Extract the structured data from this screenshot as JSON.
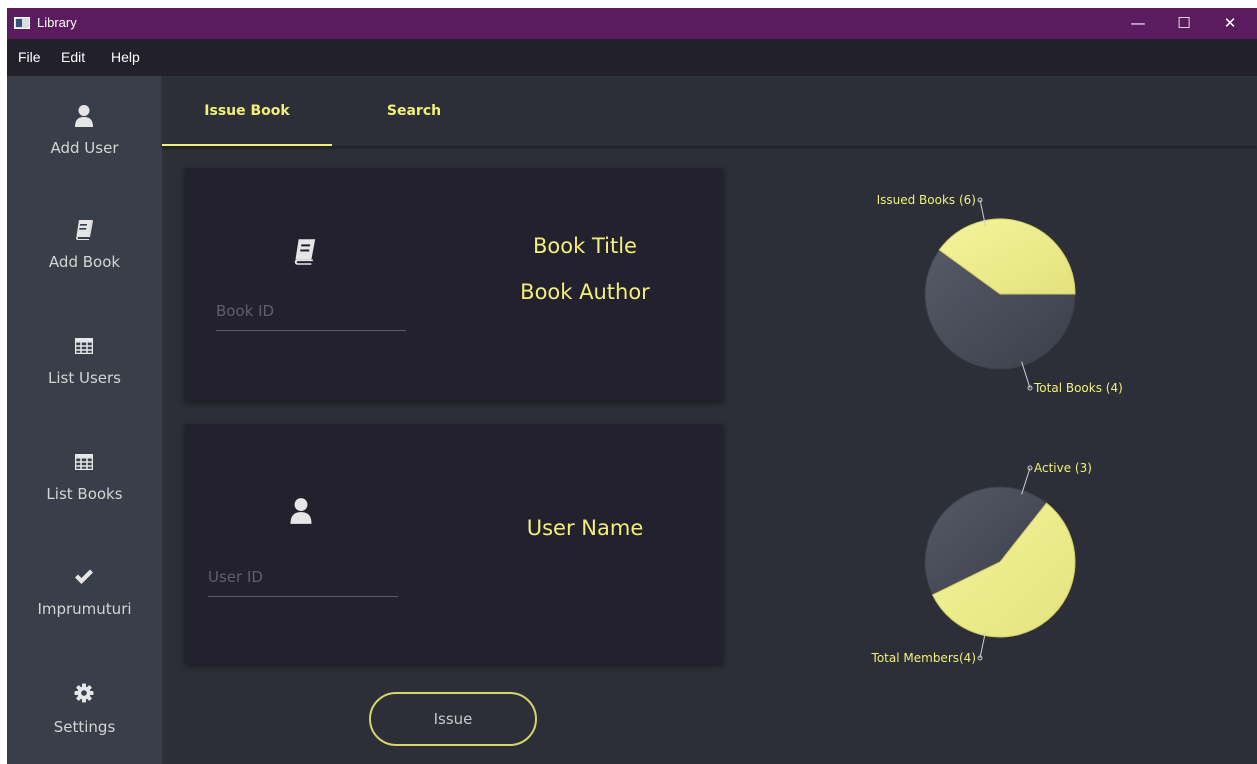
{
  "window": {
    "title": "Library",
    "controls": [
      "—",
      "☐",
      "✕"
    ]
  },
  "menu": [
    "File",
    "Edit",
    "Help"
  ],
  "sidebar": {
    "items": [
      {
        "label": "Add User",
        "icon": "user-icon"
      },
      {
        "label": "Add Book",
        "icon": "book-icon"
      },
      {
        "label": "List Users",
        "icon": "table-icon"
      },
      {
        "label": "List Books",
        "icon": "table-icon"
      },
      {
        "label": "Imprumuturi",
        "icon": "check-icon"
      },
      {
        "label": "Settings",
        "icon": "gear-icon"
      }
    ]
  },
  "tabs": [
    {
      "label": "Issue Book",
      "active": true
    },
    {
      "label": "Search",
      "active": false
    }
  ],
  "book_card": {
    "icon": "book-icon",
    "id_placeholder": "Book ID",
    "id_value": "",
    "title": "Book Title",
    "author": "Book Author"
  },
  "user_card": {
    "icon": "user-icon",
    "id_placeholder": "User ID",
    "id_value": "",
    "name": "User Name"
  },
  "issue_button": "Issue",
  "colors": {
    "accent": "#f2ef7a",
    "pie_dark": "#464b56",
    "pie_light": "#eeed8c",
    "titlebar": "#5b1b5f"
  },
  "chart_data": [
    {
      "type": "pie",
      "slices": [
        {
          "label": "Issued Books (6)",
          "value": 6
        },
        {
          "label": "Total Books (4)",
          "value": 4
        }
      ]
    },
    {
      "type": "pie",
      "slices": [
        {
          "label": "Active (3)",
          "value": 3
        },
        {
          "label": "Total Members(4)",
          "value": 4
        }
      ]
    }
  ]
}
